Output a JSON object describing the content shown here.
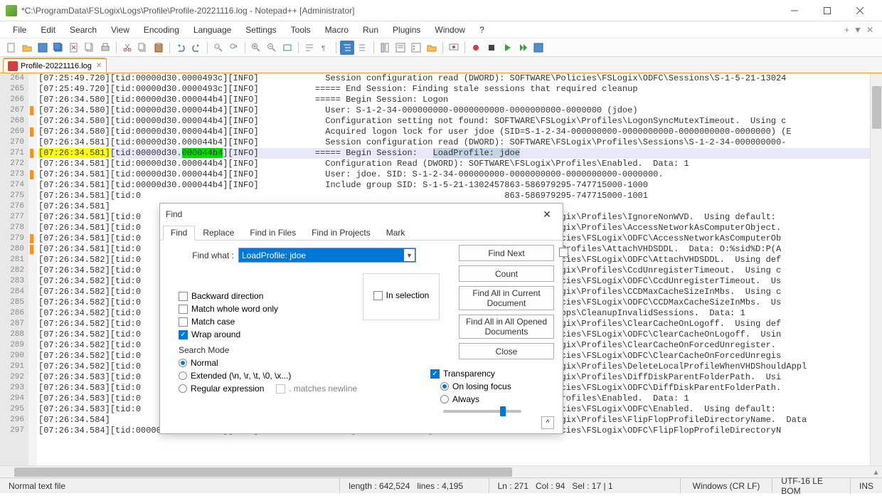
{
  "titlebar": {
    "text": "*C:\\ProgramData\\FSLogix\\Logs\\Profile\\Profile-20221116.log - Notepad++ [Administrator]"
  },
  "menubar": {
    "items": [
      "File",
      "Edit",
      "Search",
      "View",
      "Encoding",
      "Language",
      "Settings",
      "Tools",
      "Macro",
      "Run",
      "Plugins",
      "Window",
      "?"
    ]
  },
  "tab": {
    "filename": "Profile-20221116.log"
  },
  "first_line_no": 264,
  "lines": [
    {
      "t": "[07:25:49.720][tid:00000d30.0000493c][INFO]             Session configuration read (DWORD): SOFTWARE\\Policies\\FSLogix\\ODFC\\Sessions\\S-1-5-21-13024",
      "m": false
    },
    {
      "t": "[07:25:49.720][tid:00000d30.0000493c][INFO]           ===== End Session: Finding stale sessions that required cleanup",
      "m": false
    },
    {
      "t": "[07:26:34.580][tid:00000d30.000044b4][INFO]           ===== Begin Session: Logon",
      "m": false
    },
    {
      "t": "[07:26:34.580][tid:00000d30.000044b4][INFO]             User: S-1-2-34-000000000-0000000000-0000000000-0000000 (jdoe)",
      "m": true
    },
    {
      "t": "[07:26:34.580][tid:00000d30.000044b4][INFO]             Configuration setting not found: SOFTWARE\\FSLogix\\Profiles\\LogonSyncMutexTimeout.  Using c",
      "m": false
    },
    {
      "t": "[07:26:34.580][tid:00000d30.000044b4][INFO]             Acquired logon lock for user jdoe (SID=S-1-2-34-000000000-0000000000-0000000000-0000000) (E",
      "m": true
    },
    {
      "t": "[07:26:34.581][tid:00000d30.000044b4][INFO]             Session configuration read (DWORD): SOFTWARE\\FSLogix\\Profiles\\Sessions\\S-1-2-34-000000000-",
      "m": false
    },
    {
      "t": "SPECIAL_271",
      "m": true
    },
    {
      "t": "[07:26:34.581][tid:00000d30.000044b4][INFO]             Configuration Read (DWORD): SOFTWARE\\FSLogix\\Profiles\\Enabled.  Data: 1",
      "m": false
    },
    {
      "t": "[07:26:34.581][tid:00000d30.000044b4][INFO]             User: jdoe. SID: S-1-2-34-000000000-0000000000-0000000000-0000000.",
      "m": true
    },
    {
      "t": "[07:26:34.581][tid:00000d30.000044b4][INFO]             Include group SID: S-1-5-21-1302457863-586979295-747715000-1000",
      "m": false
    },
    {
      "t": "[07:26:34.581][tid:0                                                                       863-586979295-747715000-1001",
      "m": false
    },
    {
      "t": "[07:26:34.581]",
      "m": false
    },
    {
      "t": "[07:26:34.581][tid:0                                                                       FTWARE\\FSLogix\\Profiles\\IgnoreNonWVD.  Using default: ",
      "m": false
    },
    {
      "t": "[07:26:34.581][tid:0                                                                       FTWARE\\FSLogix\\Profiles\\AccessNetworkAsComputerObject.",
      "m": false
    },
    {
      "t": "[07:26:34.581][tid:0                                                                       FTWARE\\Policies\\FSLogix\\ODFC\\AccessNetworkAsComputerOb",
      "m": true
    },
    {
      "t": "[07:26:34.581][tid:0                                                                       RE\\FSLogix\\Profiles\\AttachVHDSDDL.  Data: O:%sid%D:P(A",
      "m": true
    },
    {
      "t": "[07:26:34.582][tid:0                                                                       FTWARE\\Policies\\FSLogix\\ODFC\\AttachVHDSDDL.  Using def",
      "m": false
    },
    {
      "t": "[07:26:34.582][tid:0                                                                       FTWARE\\FSLogix\\Profiles\\CcdUnregisterTimeout.  Using c",
      "m": false
    },
    {
      "t": "[07:26:34.582][tid:0                                                                       FTWARE\\Policies\\FSLogix\\ODFC\\CcdUnregisterTimeout.  Us",
      "m": false
    },
    {
      "t": "[07:26:34.582][tid:0                                                                       FTWARE\\FSLogix\\Profiles\\CCDMaxCacheSizeInMbs.  Using c",
      "m": false
    },
    {
      "t": "[07:26:34.582][tid:0                                                                       FTWARE\\Policies\\FSLogix\\ODFC\\CCDMaxCacheSizeInMbs.  Us",
      "m": false
    },
    {
      "t": "[07:26:34.582][tid:0                                                                       E\\FSLogix\\Apps\\CleanupInvalidSessions.  Data: 1",
      "m": false
    },
    {
      "t": "[07:26:34.582][tid:0                                                                       FTWARE\\FSLogix\\Profiles\\ClearCacheOnLogoff.  Using def",
      "m": false
    },
    {
      "t": "[07:26:34.582][tid:0                                                                       FTWARE\\Policies\\FSLogix\\ODFC\\ClearCacheOnLogoff.  Usin",
      "m": false
    },
    {
      "t": "[07:26:34.582][tid:0                                                                       FTWARE\\FSLogix\\Profiles\\ClearCacheOnForcedUnregister. ",
      "m": false
    },
    {
      "t": "[07:26:34.582][tid:0                                                                       FTWARE\\Policies\\FSLogix\\ODFC\\ClearCacheOnForcedUnregis",
      "m": false
    },
    {
      "t": "[07:26:34.582][tid:0                                                                       FTWARE\\FSLogix\\Profiles\\DeleteLocalProfileWhenVHDShouldAppl",
      "m": false
    },
    {
      "t": "[07:26:34.583][tid:0                                                                       FTWARE\\FSLogix\\Profiles\\DiffDiskParentFolderPath.  Usi",
      "m": false
    },
    {
      "t": "[07:26:34.583][tid:0                                                                       FTWARE\\Policies\\FSLogix\\ODFC\\DiffDiskParentFolderPath.",
      "m": false
    },
    {
      "t": "[07:26:34.583][tid:0                                                                       E\\FSLogix\\Profiles\\Enabled.  Data: 1",
      "m": false
    },
    {
      "t": "[07:26:34.583][tid:0                                                                       FTWARE\\Policies\\FSLogix\\ODFC\\Enabled.  Using default: ",
      "m": false
    },
    {
      "t": "[07:26:34.584]                                                                             FTWARE\\FSLogix\\Profiles\\FlipFlopProfileDirectoryName.  Data",
      "m": false
    },
    {
      "t": "[07:26:34.584][tid:00000d30.000044b4][INFO]             Configuration setting not found: SOFTWARE\\Policies\\FSLogix\\ODFC\\FlipFlopProfileDirectoryN",
      "m": false
    }
  ],
  "hl271": {
    "p1": "[07:26:34.581]",
    "p2": "[tid:00000d30.",
    "p3": "000044b4",
    "p4": "][INFO]           ===== Begin Session:   ",
    "p5": "LoadProfile: jdoe"
  },
  "find": {
    "title": "Find",
    "tabs": [
      "Find",
      "Replace",
      "Find in Files",
      "Find in Projects",
      "Mark"
    ],
    "find_what_label": "Find what :",
    "find_what_value": "LoadProfile: jdoe",
    "backward": "Backward direction",
    "whole_word": "Match whole word only",
    "match_case": "Match case",
    "wrap": "Wrap around",
    "search_mode": "Search Mode",
    "normal": "Normal",
    "extended": "Extended (\\n, \\r, \\t, \\0, \\x...)",
    "regex": "Regular expression",
    "matches_newline": ". matches newline",
    "in_selection": "In selection",
    "find_next": "Find Next",
    "count": "Count",
    "find_all_doc": "Find All in Current Document",
    "find_all_open": "Find All in All Opened Documents",
    "close": "Close",
    "transparency": "Transparency",
    "on_losing_focus": "On losing focus",
    "always": "Always"
  },
  "status": {
    "file_type": "Normal text file",
    "length_label": "length :",
    "length": "642,524",
    "lines_label": "lines :",
    "lines": "4,195",
    "ln_label": "Ln :",
    "ln": "271",
    "col_label": "Col :",
    "col": "94",
    "sel_label": "Sel :",
    "sel": "17 | 1",
    "eol": "Windows (CR LF)",
    "encoding": "UTF-16 LE BOM",
    "mode": "INS"
  }
}
